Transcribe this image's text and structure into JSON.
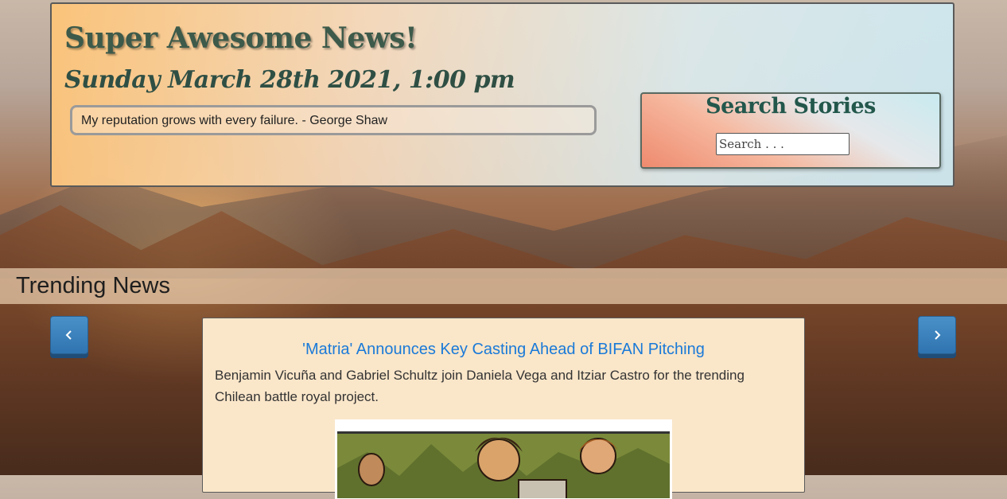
{
  "header": {
    "site_title": "Super Awesome News!",
    "date_time": "Sunday March 28th 2021, 1:00 pm",
    "quote": "My reputation grows with every failure. - George Shaw"
  },
  "search": {
    "title": "Search Stories",
    "placeholder": "Search . . ."
  },
  "trending": {
    "section_title": "Trending News",
    "prev_icon": "chevron-left-icon",
    "next_icon": "chevron-right-icon",
    "story": {
      "title": "'Matria' Announces Key Casting Ahead of BIFAN Pitching",
      "summary": "Benjamin Vicuña and Gabriel Schultz join Daniela Vega and Itziar Castro for the trending Chilean battle royal project."
    }
  },
  "colors": {
    "nav_button": "#3a82bd",
    "story_link": "#1a7ad8",
    "card_background": "#fae6c9"
  }
}
